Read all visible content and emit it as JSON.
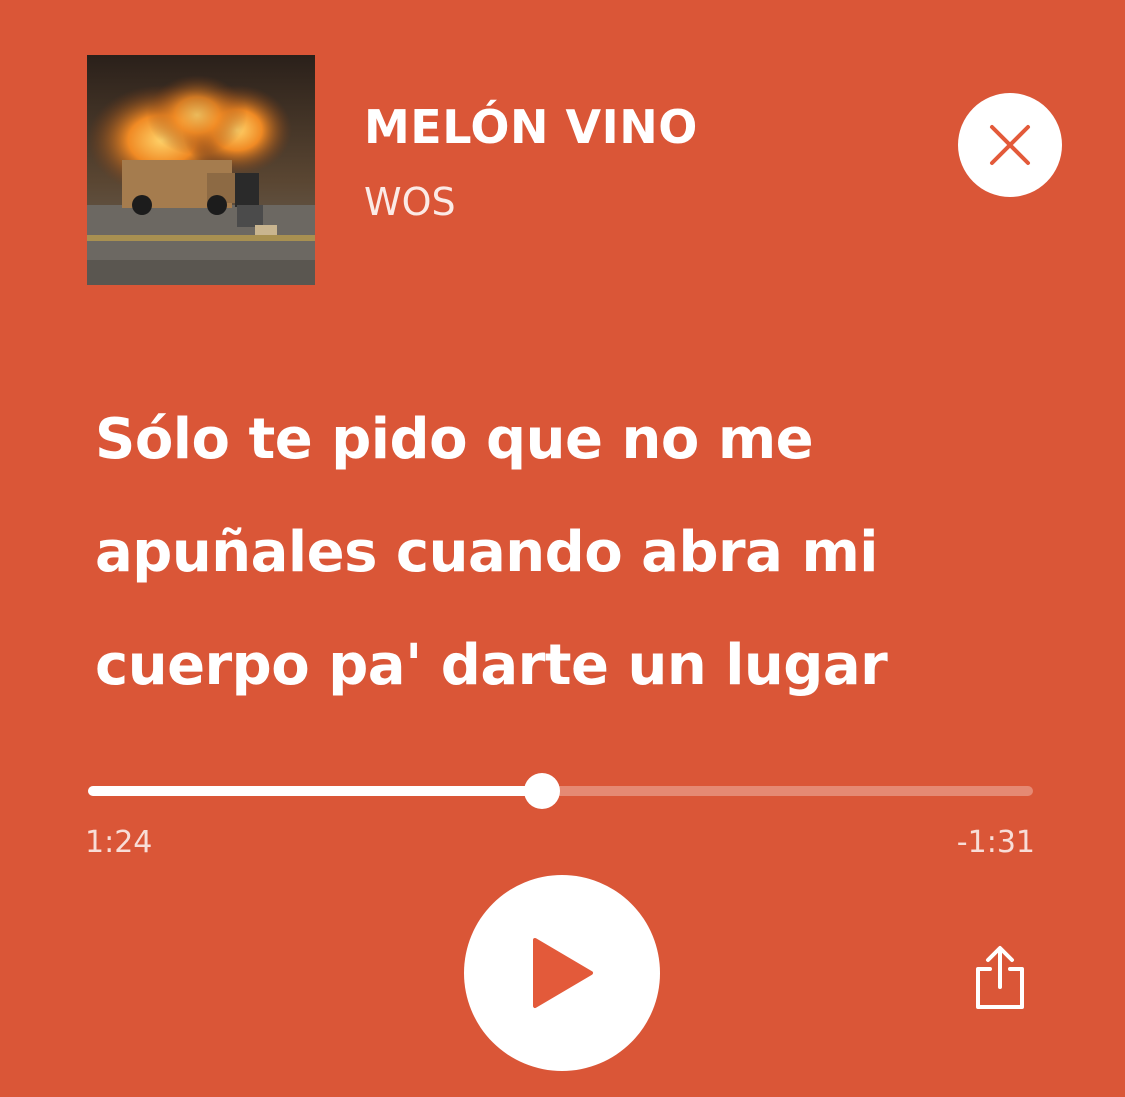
{
  "track": {
    "title": "MELÓN VINO",
    "artist": "WOS"
  },
  "lyrics": {
    "lines": [
      "Sólo te pido que no me",
      "apuñales cuando abra mi",
      "cuerpo pa' darte un lugar"
    ]
  },
  "playback": {
    "elapsed": "1:24",
    "remaining": "-1:31",
    "progress_fraction": 0.48,
    "state": "paused"
  },
  "icons": {
    "close": "close-icon",
    "play": "play-icon",
    "share": "share-icon"
  },
  "colors": {
    "background": "#DA5637",
    "accent": "#E35A3A",
    "foreground": "#FFFFFF"
  }
}
